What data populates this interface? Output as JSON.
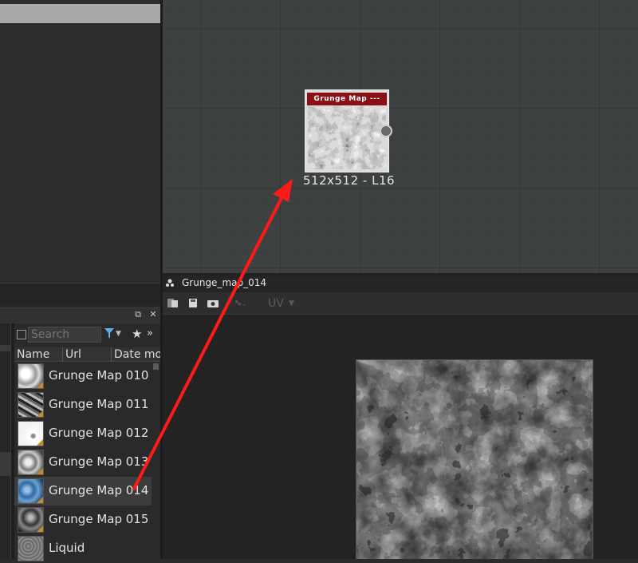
{
  "library": {
    "search_placeholder": "Search",
    "columns": [
      "Name",
      "Url",
      "Date mo"
    ],
    "items": [
      {
        "label": "Grunge Map 010",
        "selected": false
      },
      {
        "label": "Grunge Map 011",
        "selected": false
      },
      {
        "label": "Grunge Map 012",
        "selected": false
      },
      {
        "label": "Grunge Map 013",
        "selected": false
      },
      {
        "label": "Grunge Map 014",
        "selected": true
      },
      {
        "label": "Grunge Map 015",
        "selected": false
      },
      {
        "label": "Liquid",
        "selected": false
      }
    ],
    "header_icons": [
      "restore-icon",
      "close-icon"
    ],
    "close_glyph": "✕",
    "restore_glyph": "⧉"
  },
  "graph": {
    "node": {
      "title": "Grunge Map ---",
      "size_label": "512x512 - L16"
    }
  },
  "viewer": {
    "title": "Grunge_map_014",
    "uv_label": "UV"
  },
  "colors": {
    "node_title_bg": "#8b1015",
    "annotation_arrow": "#ff1a1a",
    "thumb_corner": "#c88a2c"
  }
}
